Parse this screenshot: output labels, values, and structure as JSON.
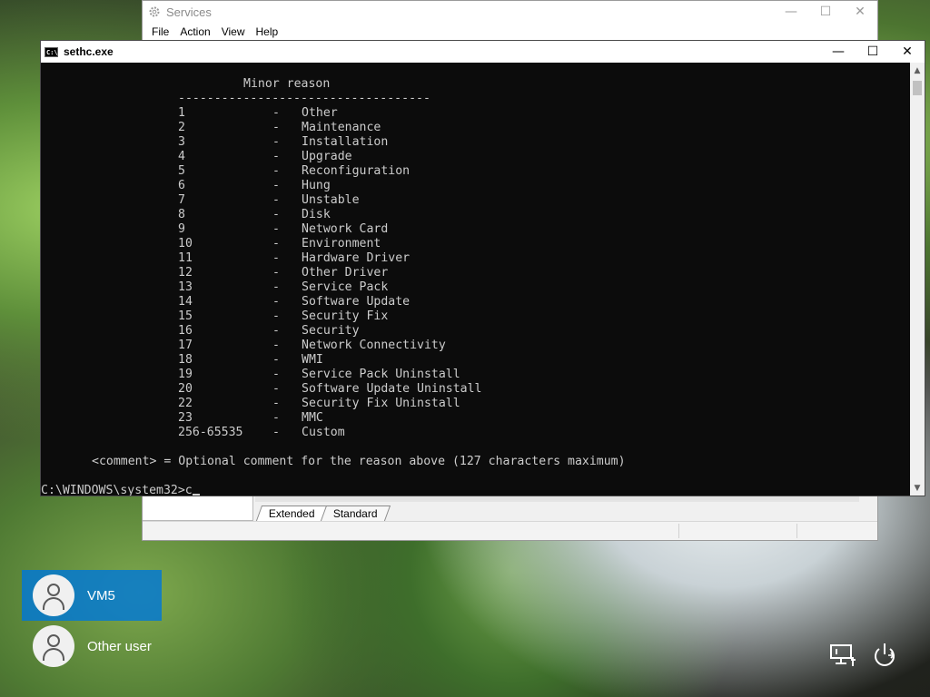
{
  "services_window": {
    "title": "Services",
    "menu": [
      "File",
      "Action",
      "View",
      "Help"
    ],
    "tabs": [
      "Extended",
      "Standard"
    ]
  },
  "console": {
    "title": "sethc.exe",
    "heading": "Minor reason",
    "separator": "-----------------------------------",
    "reasons": [
      {
        "code": "1",
        "label": "Other"
      },
      {
        "code": "2",
        "label": "Maintenance"
      },
      {
        "code": "3",
        "label": "Installation"
      },
      {
        "code": "4",
        "label": "Upgrade"
      },
      {
        "code": "5",
        "label": "Reconfiguration"
      },
      {
        "code": "6",
        "label": "Hung"
      },
      {
        "code": "7",
        "label": "Unstable"
      },
      {
        "code": "8",
        "label": "Disk"
      },
      {
        "code": "9",
        "label": "Network Card"
      },
      {
        "code": "10",
        "label": "Environment"
      },
      {
        "code": "11",
        "label": "Hardware Driver"
      },
      {
        "code": "12",
        "label": "Other Driver"
      },
      {
        "code": "13",
        "label": "Service Pack"
      },
      {
        "code": "14",
        "label": "Software Update"
      },
      {
        "code": "15",
        "label": "Security Fix"
      },
      {
        "code": "16",
        "label": "Security"
      },
      {
        "code": "17",
        "label": "Network Connectivity"
      },
      {
        "code": "18",
        "label": "WMI"
      },
      {
        "code": "19",
        "label": "Service Pack Uninstall"
      },
      {
        "code": "20",
        "label": "Software Update Uninstall"
      },
      {
        "code": "22",
        "label": "Security Fix Uninstall"
      },
      {
        "code": "23",
        "label": "MMC"
      },
      {
        "code": "256-65535",
        "label": "Custom"
      }
    ],
    "comment_line": "<comment> = Optional comment for the reason above (127 characters maximum)",
    "prompt": "C:\\WINDOWS\\system32>",
    "typed": "c"
  },
  "users": [
    {
      "name": "VM5",
      "selected": true
    },
    {
      "name": "Other user",
      "selected": false
    }
  ],
  "tray_icons": [
    "network-icon",
    "power-icon"
  ]
}
